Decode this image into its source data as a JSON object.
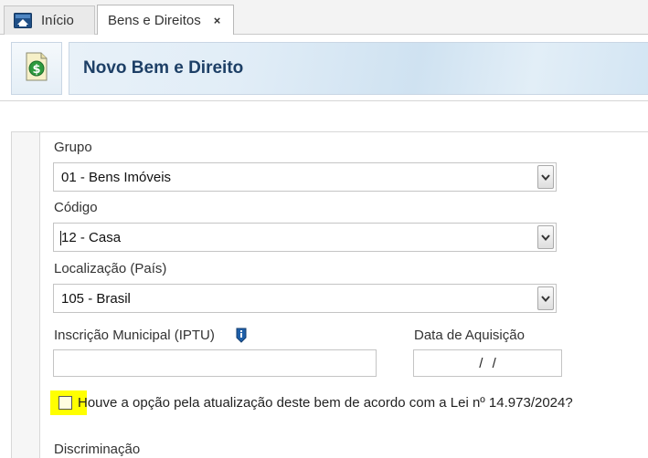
{
  "tabs": [
    {
      "label": "Início"
    },
    {
      "label": "Bens e Direitos",
      "close": "×"
    }
  ],
  "header": {
    "title": "Novo Bem e Direito"
  },
  "form": {
    "grupo": {
      "label": "Grupo",
      "value": "01 - Bens Imóveis"
    },
    "codigo": {
      "label": "Código",
      "value": "12 - Casa"
    },
    "localizacao": {
      "label": "Localização (País)",
      "value": "105 - Brasil"
    },
    "inscricao": {
      "label": "Inscrição Municipal (IPTU)",
      "value": ""
    },
    "data_aquisicao": {
      "label": "Data de Aquisição",
      "value": "/ /"
    },
    "opcao_atualizacao": {
      "label": "Houve a opção pela atualização deste bem de acordo com a Lei nº 14.973/2024?",
      "checked": false
    },
    "discriminacao": {
      "label": "Discriminação"
    }
  },
  "colors": {
    "title": "#1d3f66",
    "highlight": "#ffff00",
    "info_icon": "#1f5fa8"
  },
  "icons": [
    "home-icon",
    "money-document-icon",
    "info-icon",
    "chevron-down-icon"
  ]
}
